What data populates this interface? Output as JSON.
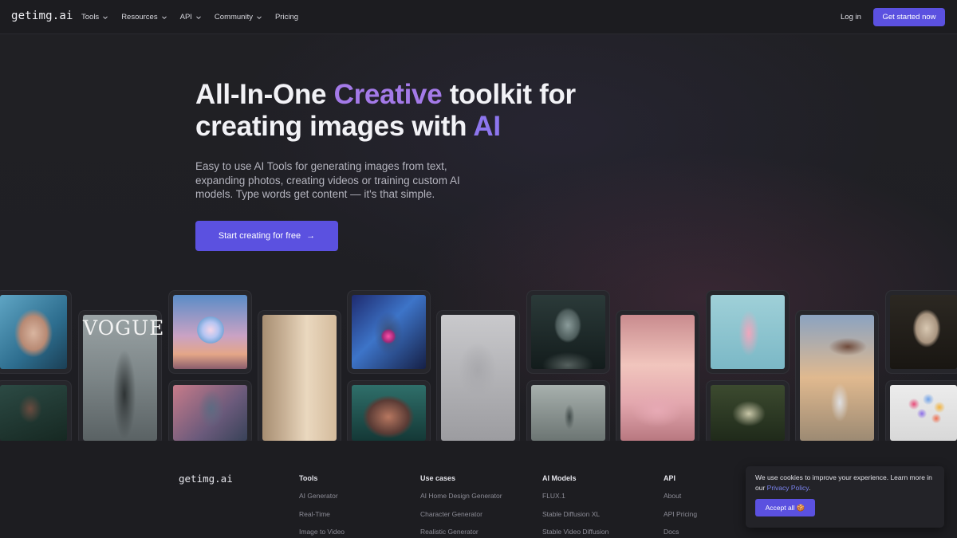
{
  "nav": {
    "logo": "getimg.ai",
    "items": [
      {
        "label": "Tools",
        "dropdown": true
      },
      {
        "label": "Resources",
        "dropdown": true
      },
      {
        "label": "API",
        "dropdown": true
      },
      {
        "label": "Community",
        "dropdown": true
      },
      {
        "label": "Pricing",
        "dropdown": false
      }
    ],
    "login": "Log in",
    "cta": "Get started now"
  },
  "hero": {
    "title_part1": "All-In-One ",
    "title_highlight1": "Creative",
    "title_part2": " toolkit for creating images with ",
    "title_highlight2": "AI",
    "subtitle": "Easy to use AI Tools for generating images from text, expanding photos, creating videos or training custom AI models. Type words get content — it's that simple.",
    "cta": "Start creating for free",
    "cta_icon": "arrow-right-icon"
  },
  "gallery": {
    "tiles": [
      {
        "name": "woman-portrait-image"
      },
      {
        "name": "dark-figure-image"
      },
      {
        "name": "vogue-cover-image",
        "text": "VOGUE"
      },
      {
        "name": "glass-sphere-image"
      },
      {
        "name": "ai-woman-image"
      },
      {
        "name": "interior-room-image"
      },
      {
        "name": "neon-robot-image"
      },
      {
        "name": "green-face-image"
      },
      {
        "name": "sketch-head-image"
      },
      {
        "name": "alien-bust-image"
      },
      {
        "name": "misty-figure-image"
      },
      {
        "name": "pink-room-image"
      },
      {
        "name": "dancer-image"
      },
      {
        "name": "jungle-room-image"
      },
      {
        "name": "astronaut-image"
      },
      {
        "name": "statue-woman-image"
      },
      {
        "name": "balloon-tree-image"
      }
    ]
  },
  "footer": {
    "logo": "getimg.ai",
    "columns": [
      {
        "heading": "Tools",
        "links": [
          "AI Generator",
          "Real-Time",
          "Image to Video"
        ]
      },
      {
        "heading": "Use cases",
        "links": [
          "AI Home Design Generator",
          "Character Generator",
          "Realistic Generator"
        ]
      },
      {
        "heading": "AI Models",
        "links": [
          "FLUX.1",
          "Stable Diffusion XL",
          "Stable Video Diffusion"
        ]
      },
      {
        "heading": "API",
        "links": [
          "About",
          "API Pricing",
          "Docs"
        ]
      }
    ]
  },
  "cookie": {
    "text": "We use cookies to improve your experience. Learn more in our ",
    "link": "Privacy Policy",
    "text_end": ".",
    "button": "Accept all 🍪"
  },
  "colors": {
    "accent": "#5b51e0",
    "highlight_creative": "#a47ae8",
    "highlight_ai": "#8d76ee",
    "link": "#7b84f0",
    "background": "#1d1d21"
  }
}
